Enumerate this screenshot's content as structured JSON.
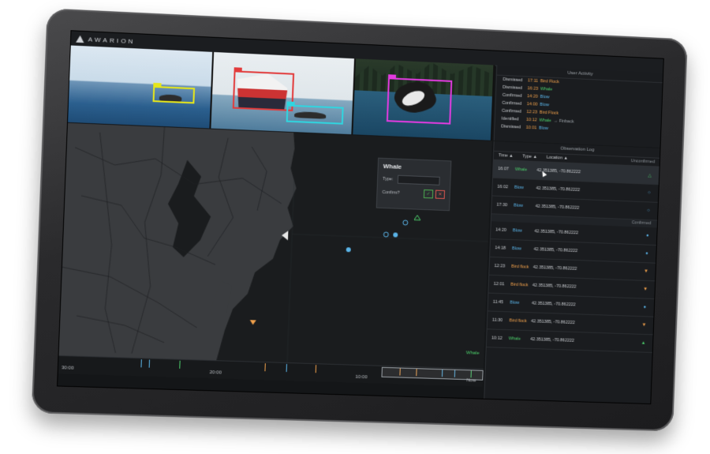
{
  "app": {
    "brand": "AWARION"
  },
  "activity": {
    "title": "User Activity",
    "rows": [
      {
        "verb": "Dismissed",
        "time": "17:11",
        "label": "Bird Flock",
        "color": "#f0a04b",
        "extra": ""
      },
      {
        "verb": "Dismissed",
        "time": "16:23",
        "label": "Whale",
        "color": "#4ccf6b",
        "extra": ""
      },
      {
        "verb": "Confirmed",
        "time": "14:20",
        "label": "Blow",
        "color": "#5ab4e8",
        "extra": ""
      },
      {
        "verb": "Confirmed",
        "time": "14:00",
        "label": "Blow",
        "color": "#5ab4e8",
        "extra": ""
      },
      {
        "verb": "Confirmed",
        "time": "12:23",
        "label": "Bird Flock",
        "color": "#f0a04b",
        "extra": ""
      },
      {
        "verb": "Identified",
        "time": "10:12",
        "label": "Whale",
        "color": "#4ccf6b",
        "extra": "→ Finback"
      },
      {
        "verb": "Dismissed",
        "time": "10:01",
        "label": "Blow",
        "color": "#5ab4e8",
        "extra": ""
      }
    ]
  },
  "popup": {
    "title": "Whale",
    "type_label": "Type:",
    "confirm_label": "Confirm?",
    "ok_icon": "✓",
    "cancel_icon": "✕"
  },
  "map": {
    "whale_label": "Whale"
  },
  "timeline": {
    "labels": [
      "30:00",
      "20:00",
      "10:00",
      "Now"
    ],
    "ticks": [
      {
        "pos": 0.19,
        "color": "#5ab4e8"
      },
      {
        "pos": 0.21,
        "color": "#5ab4e8"
      },
      {
        "pos": 0.28,
        "color": "#4ccf6b"
      },
      {
        "pos": 0.48,
        "color": "#f0a04b"
      },
      {
        "pos": 0.53,
        "color": "#5ab4e8"
      },
      {
        "pos": 0.6,
        "color": "#f0a04b"
      },
      {
        "pos": 0.8,
        "color": "#f0a04b"
      },
      {
        "pos": 0.84,
        "color": "#f0a04b"
      },
      {
        "pos": 0.9,
        "color": "#5ab4e8"
      },
      {
        "pos": 0.93,
        "color": "#5ab4e8"
      },
      {
        "pos": 0.97,
        "color": "#4ccf6b"
      }
    ]
  },
  "obs": {
    "title": "Observation Log",
    "headers": [
      "Time ▲",
      "Type ▲",
      "Location ▲"
    ],
    "unconfirmed_label": "Unconfirmed",
    "confirmed_label": "Confirmed",
    "unconfirmed": [
      {
        "time": "16:07",
        "type": "Whale",
        "kind": "whale",
        "loc": "42.351385, -70.862222",
        "sym": "△"
      },
      {
        "time": "16:02",
        "type": "Blow",
        "kind": "blow",
        "loc": "42.351385, -70.862222",
        "sym": "○"
      },
      {
        "time": "17:30",
        "type": "Blow",
        "kind": "blow",
        "loc": "42.351385, -70.862222",
        "sym": "○"
      }
    ],
    "confirmed": [
      {
        "time": "14:20",
        "type": "Blow",
        "kind": "blow",
        "loc": "42.351385, -70.862222",
        "sym": "●"
      },
      {
        "time": "14:18",
        "type": "Blow",
        "kind": "blow",
        "loc": "42.351385, -70.862222",
        "sym": "●"
      },
      {
        "time": "12:23",
        "type": "Bird flock",
        "kind": "bird",
        "loc": "42.351385, -70.862222",
        "sym": "▼"
      },
      {
        "time": "12:01",
        "type": "Bird flock",
        "kind": "bird",
        "loc": "42.351385, -70.862222",
        "sym": "▼"
      },
      {
        "time": "11:45",
        "type": "Blow",
        "kind": "blow",
        "loc": "42.351385, -70.862222",
        "sym": "●"
      },
      {
        "time": "11:30",
        "type": "Bird flock",
        "kind": "bird",
        "loc": "42.351385, -70.862222",
        "sym": "▼"
      },
      {
        "time": "10:12",
        "type": "Whale",
        "kind": "whale",
        "loc": "42.351385, -70.862222",
        "sym": "▲"
      }
    ]
  },
  "colors": {
    "whale": "#4ccf6b",
    "blow": "#5ab4e8",
    "bird": "#f0a04b"
  }
}
